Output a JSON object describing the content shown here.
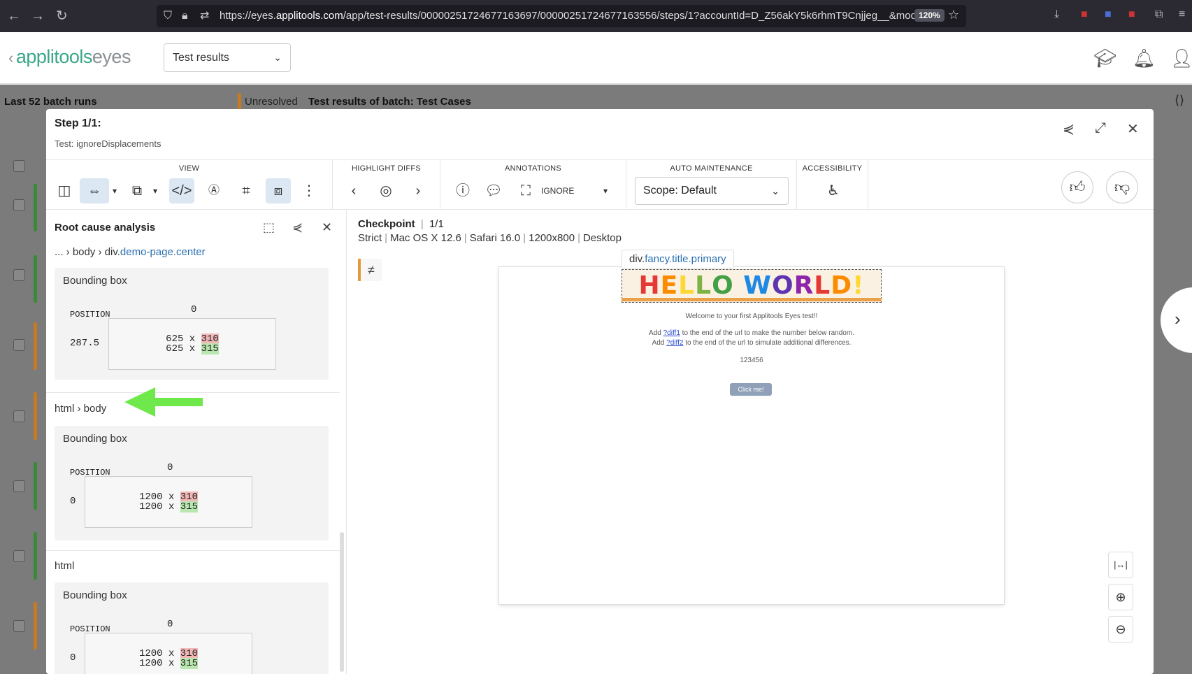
{
  "browser": {
    "url_prefix": "https://eyes.",
    "url_host": "applitools.com",
    "url_path": "/app/test-results/00000251724677163697/00000251724677163556/steps/1?accountId=D_Z56akY5k6rhmT9Cnjjeg__&mod",
    "zoom": "120%"
  },
  "header": {
    "logo_brand": "applitools",
    "logo_product": "eyes",
    "view_select": "Test results"
  },
  "underlay": {
    "batch_runs": "Last 52 batch runs",
    "status": "Unresolved",
    "batch_title": "Test results of batch: Test Cases"
  },
  "modal": {
    "step_title": "Step 1/1:",
    "test_name": "Test: ignoreDisplacements"
  },
  "toolbar": {
    "view": "VIEW",
    "highlight_diffs": "HIGHLIGHT DIFFS",
    "annotations": "ANNOTATIONS",
    "ignore": "IGNORE",
    "auto_maintenance": "AUTO MAINTENANCE",
    "scope": "Scope: Default",
    "accessibility": "ACCESSIBILITY"
  },
  "rca": {
    "title": "Root cause analysis",
    "crumb1_prefix": "... › body › div.",
    "crumb1_class": "demo-page.center",
    "bbox_title": "Bounding box",
    "position_label": "POSITION",
    "boxes": [
      {
        "top": "0",
        "left": "287.5",
        "width": "625",
        "h_old": "310",
        "h_new": "315"
      },
      {
        "top": "0",
        "left": "0",
        "width": "1200",
        "h_old": "310",
        "h_new": "315"
      },
      {
        "top": "0",
        "left": "0",
        "width": "1200",
        "h_old": "310",
        "h_new": "315"
      }
    ],
    "crumb2": "html › body",
    "crumb3": "html"
  },
  "checkpoint": {
    "label": "Checkpoint",
    "count": "1/1",
    "match_level": "Strict",
    "os": "Mac OS X 12.6",
    "browser": "Safari 16.0",
    "viewport": "1200x800",
    "device": "Desktop"
  },
  "screenshot": {
    "tooltip_prefix": "div.",
    "tooltip_class": "fancy.title.primary",
    "hello": "HELLO WORLD!",
    "welcome": "Welcome to your first Applitools Eyes test!!",
    "line1_a": "Add ",
    "line1_link": "?diff1",
    "line1_b": " to the end of the url to make the number below random.",
    "line2_a": "Add ",
    "line2_link": "?diff2",
    "line2_b": " to the end of the url to simulate additional differences.",
    "number": "123456",
    "button": "Click me!"
  },
  "colors": {
    "brand": "#3aa788",
    "stripe_green": "#3a8a3a",
    "stripe_orange": "#c87a22",
    "diff_old": "#f2b7b7",
    "diff_new": "#b9e7b0"
  }
}
